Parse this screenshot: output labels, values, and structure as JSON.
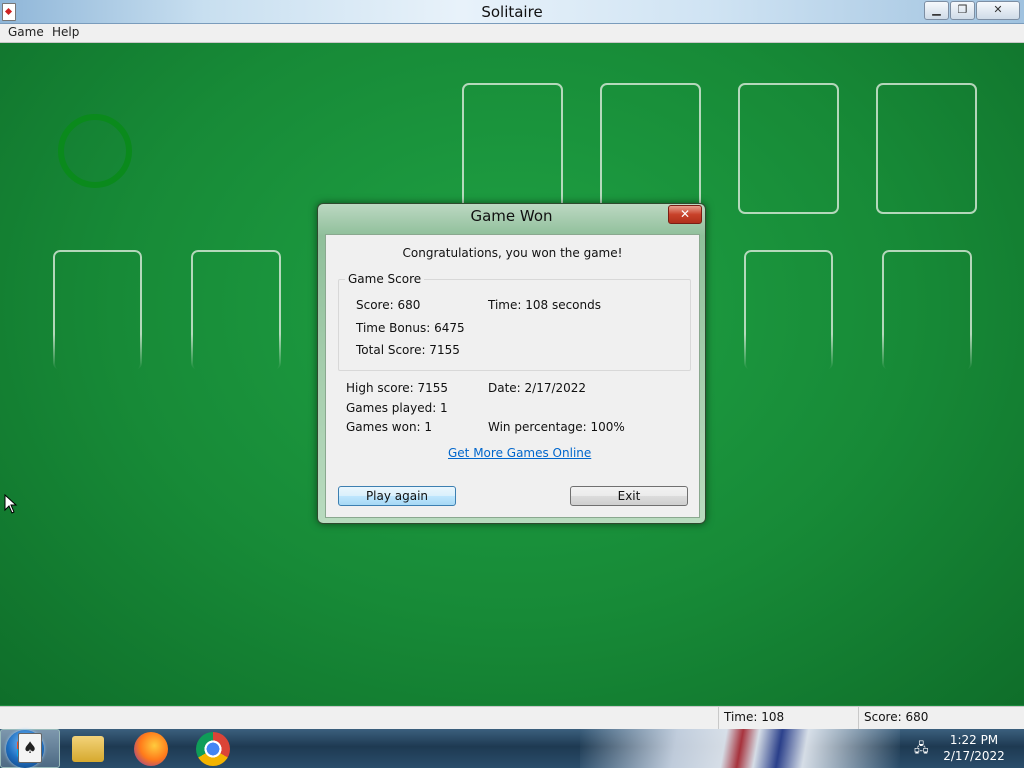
{
  "window": {
    "title": "Solitaire",
    "controls": {
      "minimize": "▁",
      "maximize": "❐",
      "close": "✕"
    }
  },
  "menu": {
    "items": [
      "Game",
      "Help"
    ]
  },
  "dialog": {
    "title": "Game Won",
    "close": "✕",
    "message": "Congratulations, you won the game!",
    "score_group_label": "Game Score",
    "score": "Score: 680",
    "time": "Time:  108 seconds",
    "time_bonus": "Time Bonus: 6475",
    "total_score": "Total Score: 7155",
    "high_score": "High score: 7155",
    "date": "Date: 2/17/2022",
    "games_played": "Games played: 1",
    "games_won": "Games won: 1",
    "win_percentage": "Win percentage: 100%",
    "more_games_link": "Get More Games Online",
    "play_again": "Play again",
    "exit": "Exit"
  },
  "status": {
    "time": "Time: 108",
    "score": "Score: 680"
  },
  "taskbar": {
    "apps": [
      "start-orb",
      "windows-explorer",
      "firefox",
      "chrome",
      "solitaire"
    ],
    "clock_time": "1:22 PM",
    "clock_date": "2/17/2022"
  },
  "colors": {
    "felt": "#178a37",
    "dialog_frame": "#a9d0b0",
    "link": "#0066cc",
    "close_button": "#c8412a"
  }
}
